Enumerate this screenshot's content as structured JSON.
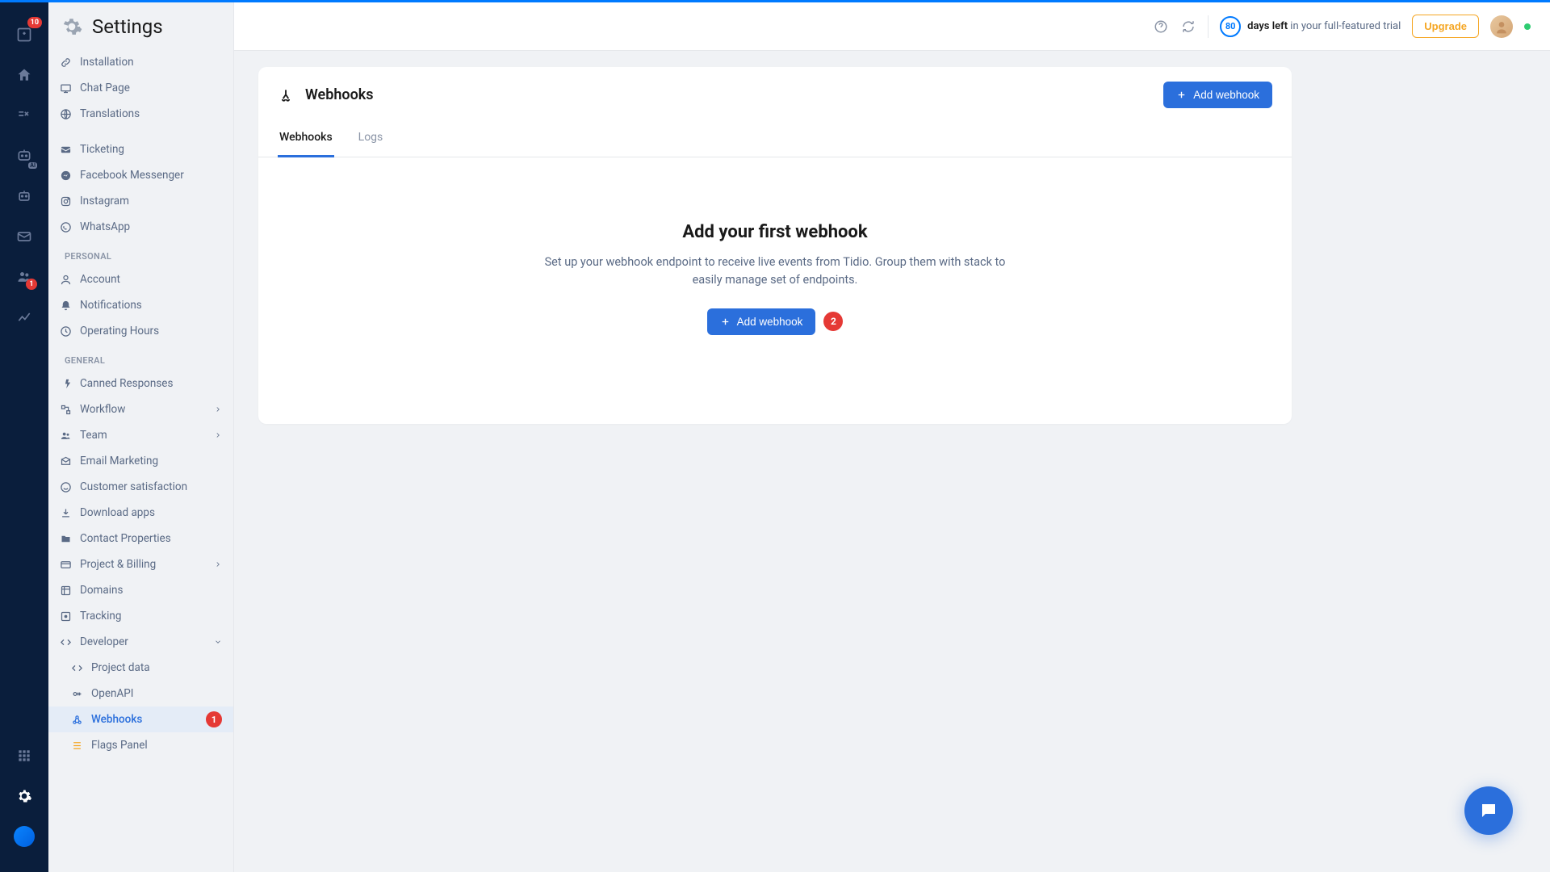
{
  "header": {
    "title": "Settings"
  },
  "topbar": {
    "days_left": "80",
    "trial_bold": "days left",
    "trial_rest": " in your full-featured trial",
    "upgrade": "Upgrade"
  },
  "rail": {
    "inbox_badge": "10",
    "contacts_badge": "1"
  },
  "sidebar": {
    "items_top": [
      {
        "label": "Installation",
        "icon": "link"
      },
      {
        "label": "Chat Page",
        "icon": "laptop"
      },
      {
        "label": "Translations",
        "icon": "globe"
      }
    ],
    "group_channels": [
      {
        "label": "Ticketing",
        "icon": "mail"
      },
      {
        "label": "Facebook Messenger",
        "icon": "messenger"
      },
      {
        "label": "Instagram",
        "icon": "instagram"
      },
      {
        "label": "WhatsApp",
        "icon": "whatsapp"
      }
    ],
    "section_personal": "PERSONAL",
    "group_personal": [
      {
        "label": "Account",
        "icon": "user"
      },
      {
        "label": "Notifications",
        "icon": "bell"
      },
      {
        "label": "Operating Hours",
        "icon": "clock"
      }
    ],
    "section_general": "GENERAL",
    "group_general": [
      {
        "label": "Canned Responses",
        "icon": "bolt"
      },
      {
        "label": "Workflow",
        "icon": "workflow",
        "chev": true
      },
      {
        "label": "Team",
        "icon": "team",
        "chev": true
      },
      {
        "label": "Email Marketing",
        "icon": "envelope-open"
      },
      {
        "label": "Customer satisfaction",
        "icon": "smile"
      },
      {
        "label": "Download apps",
        "icon": "download"
      },
      {
        "label": "Contact Properties",
        "icon": "folder"
      },
      {
        "label": "Project & Billing",
        "icon": "card",
        "chev": true
      },
      {
        "label": "Domains",
        "icon": "domain"
      },
      {
        "label": "Tracking",
        "icon": "tracking"
      },
      {
        "label": "Developer",
        "icon": "code",
        "chev_down": true
      }
    ],
    "group_developer": [
      {
        "label": "Project data",
        "icon": "code"
      },
      {
        "label": "OpenAPI",
        "icon": "key"
      },
      {
        "label": "Webhooks",
        "icon": "webhook",
        "active": true,
        "badge": "1"
      },
      {
        "label": "Flags Panel",
        "icon": "flags"
      }
    ]
  },
  "card": {
    "title": "Webhooks",
    "add_btn": "Add webhook",
    "tabs": [
      {
        "label": "Webhooks",
        "active": true
      },
      {
        "label": "Logs",
        "active": false
      }
    ],
    "empty": {
      "title": "Add your first webhook",
      "desc": "Set up your webhook endpoint to receive live events from Tidio. Group them with stack to easily manage set of endpoints.",
      "cta": "Add webhook",
      "step_badge": "2"
    }
  }
}
